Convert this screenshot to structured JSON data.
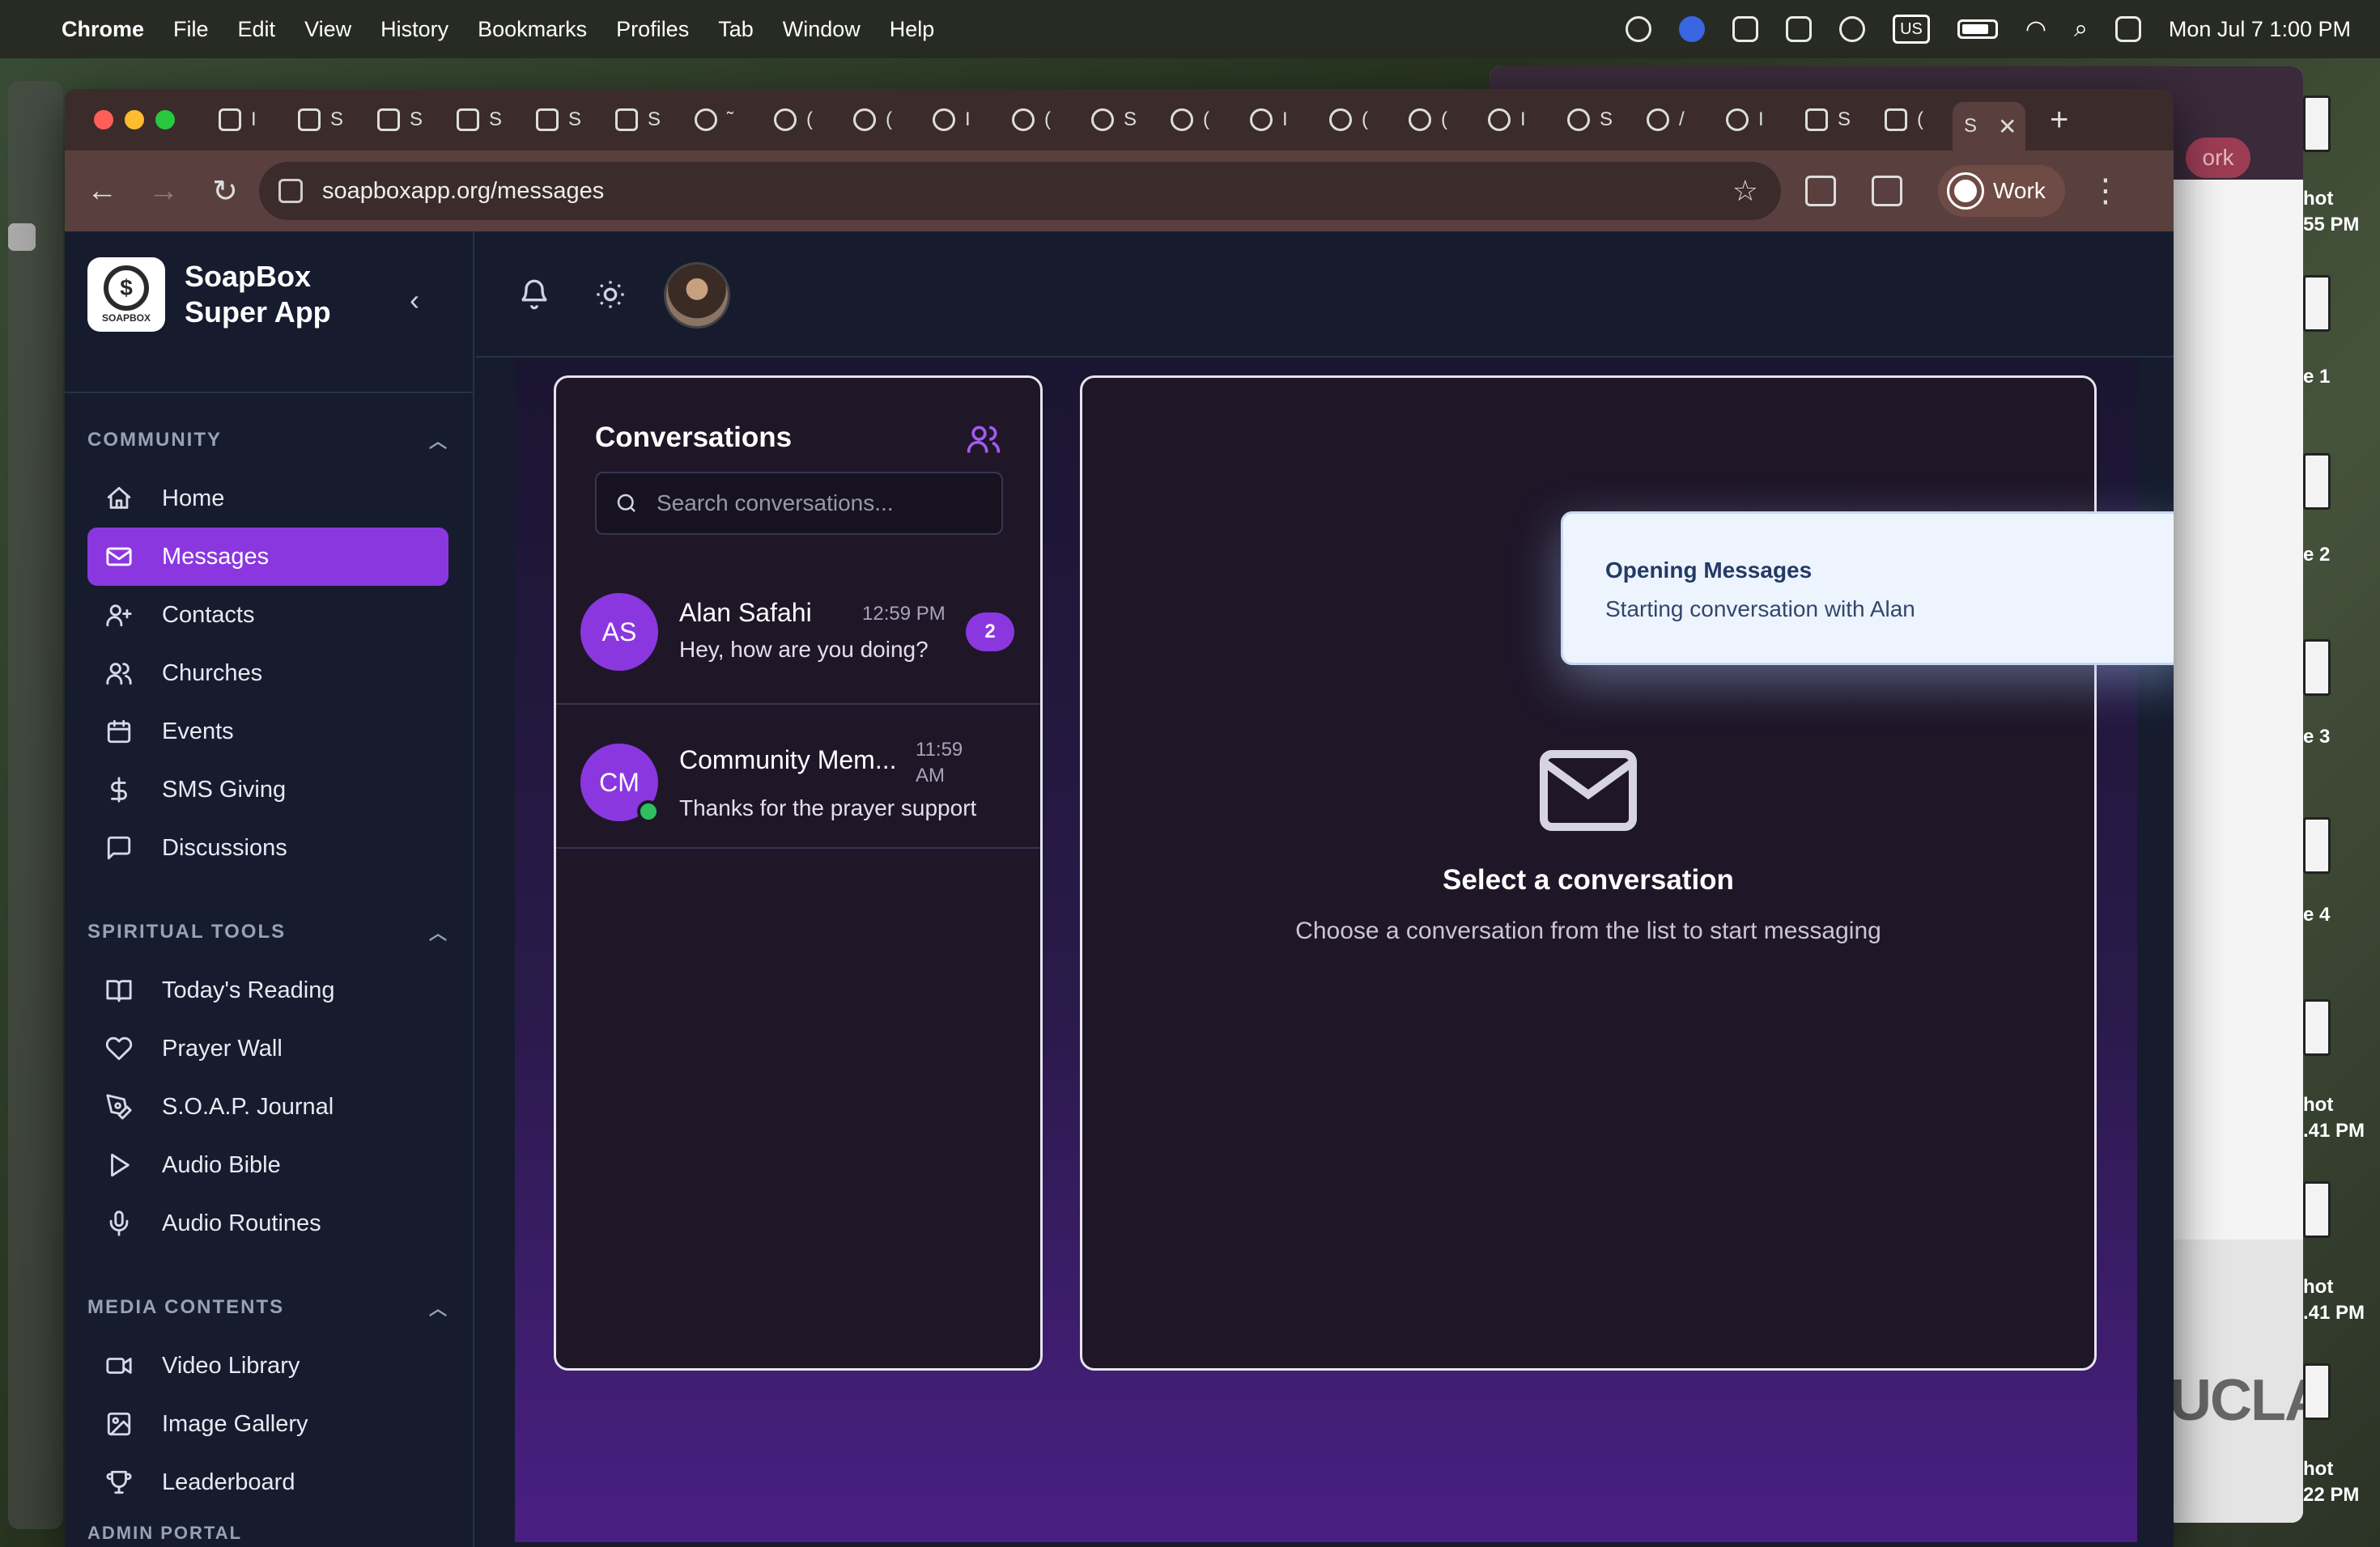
{
  "menubar": {
    "app": "Chrome",
    "items": [
      "File",
      "Edit",
      "View",
      "History",
      "Bookmarks",
      "Profiles",
      "Tab",
      "Window",
      "Help"
    ],
    "input_source": "US",
    "datetime": "Mon Jul 7  1:00 PM"
  },
  "desktop": {
    "labels": [
      "hot\n55 PM",
      "e 1",
      "e 2",
      "e 3",
      "e 4",
      "hot\n.41 PM",
      "hot\n.41 PM",
      "hot\n22 PM"
    ],
    "bg_window_pill": "ork",
    "bg_window_logo": "UCLA"
  },
  "browser": {
    "url": "soapboxapp.org/messages",
    "profile": "Work",
    "tabs": [
      {
        "icon": "gmail-icon",
        "label": "I"
      },
      {
        "icon": "doc-icon",
        "label": "S"
      },
      {
        "icon": "sheets-icon",
        "label": "S"
      },
      {
        "icon": "docs-icon",
        "label": "S"
      },
      {
        "icon": "docs-icon",
        "label": "S"
      },
      {
        "icon": "docs-icon",
        "label": "S"
      },
      {
        "icon": "globe-icon",
        "label": "˜"
      },
      {
        "icon": "globe-icon",
        "label": "("
      },
      {
        "icon": "globe-icon",
        "label": "("
      },
      {
        "icon": "globe-icon",
        "label": "I"
      },
      {
        "icon": "globe-icon",
        "label": "("
      },
      {
        "icon": "globe-icon",
        "label": "S"
      },
      {
        "icon": "globe-icon",
        "label": "("
      },
      {
        "icon": "globe-icon",
        "label": "I"
      },
      {
        "icon": "globe-icon",
        "label": "("
      },
      {
        "icon": "globe-icon",
        "label": "("
      },
      {
        "icon": "globe-icon",
        "label": "I"
      },
      {
        "icon": "globe-icon",
        "label": "S"
      },
      {
        "icon": "globe-icon",
        "label": "/"
      },
      {
        "icon": "globe-icon",
        "label": "I"
      },
      {
        "icon": "slack-icon",
        "label": "S"
      },
      {
        "icon": "linkedin-icon",
        "label": "("
      }
    ],
    "active_tab_label": "S"
  },
  "sidebar": {
    "brand_line1": "SoapBox",
    "brand_line2": "Super App",
    "logo_text": "SOAPBOX",
    "sections": [
      {
        "title": "COMMUNITY",
        "items": [
          {
            "label": "Home",
            "icon": "home-icon"
          },
          {
            "label": "Messages",
            "icon": "mail-icon",
            "active": true
          },
          {
            "label": "Contacts",
            "icon": "user-plus-icon"
          },
          {
            "label": "Churches",
            "icon": "users-icon"
          },
          {
            "label": "Events",
            "icon": "calendar-icon"
          },
          {
            "label": "SMS Giving",
            "icon": "dollar-icon"
          },
          {
            "label": "Discussions",
            "icon": "chat-icon"
          }
        ]
      },
      {
        "title": "SPIRITUAL TOOLS",
        "items": [
          {
            "label": "Today's Reading",
            "icon": "book-icon"
          },
          {
            "label": "Prayer Wall",
            "icon": "heart-icon"
          },
          {
            "label": "S.O.A.P. Journal",
            "icon": "pen-icon"
          },
          {
            "label": "Audio Bible",
            "icon": "play-icon"
          },
          {
            "label": "Audio Routines",
            "icon": "mic-icon"
          }
        ]
      },
      {
        "title": "MEDIA CONTENTS",
        "items": [
          {
            "label": "Video Library",
            "icon": "video-icon"
          },
          {
            "label": "Image Gallery",
            "icon": "image-icon"
          },
          {
            "label": "Leaderboard",
            "icon": "trophy-icon"
          }
        ]
      }
    ],
    "next_section_peek": "ADMIN PORTAL"
  },
  "conversations": {
    "title": "Conversations",
    "search_placeholder": "Search conversations...",
    "items": [
      {
        "initials": "AS",
        "name": "Alan Safahi",
        "time": "12:59 PM",
        "message": "Hey, how are you doing?",
        "unread": "2",
        "online": false
      },
      {
        "initials": "CM",
        "name": "Community Mem...",
        "time_line1": "11:59",
        "time_line2": "AM",
        "message": "Thanks for the prayer support",
        "online": true
      }
    ]
  },
  "empty_state": {
    "title": "Select a conversation",
    "subtitle": "Choose a conversation from the list to start messaging"
  },
  "toast": {
    "title": "Opening Messages",
    "message": "Starting conversation with Alan"
  },
  "colors": {
    "accent": "#8b37e0",
    "app_bg": "#161b2e",
    "online": "#2fbf5e"
  }
}
